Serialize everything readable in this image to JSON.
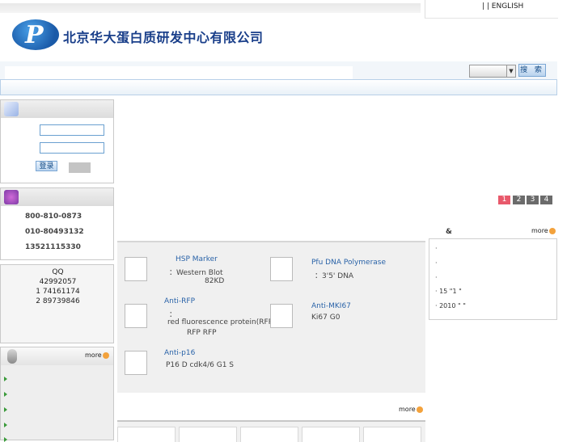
{
  "header": {
    "top_links": "|    | ENGLISH",
    "company_name": "北京华大蛋白质研发中心有限公司",
    "logo_letter": "P",
    "search_button": "搜 索",
    "search_select": ""
  },
  "login": {
    "login_button": "登录",
    "register_button": ""
  },
  "contact": {
    "phones": [
      "800-810-0873",
      "010-80493132",
      "13521115330"
    ]
  },
  "qq": {
    "label": "QQ",
    "numbers": [
      "42992057",
      "1 74161174",
      "2 89739846"
    ]
  },
  "news": {
    "more_label": "more",
    "item_count_marker": ""
  },
  "pager": [
    "1",
    "2",
    "3",
    "4"
  ],
  "products": [
    {
      "title": "HSP Marker",
      "lines": [
        "：Western Blot",
        "82KD"
      ]
    },
    {
      "title": "Pfu DNA Polymerase",
      "lines": [
        "：3'5'              DNA"
      ]
    },
    {
      "title": "Anti-RFP",
      "lines": [
        "：",
        "red fluorescence protein(RFP)",
        "RFP      RFP"
      ]
    },
    {
      "title": "Anti-MKI67",
      "lines": [
        "Ki67    G0"
      ]
    },
    {
      "title": "Anti-p16",
      "lines": [
        "P16     D     cdk4/6      G1   S"
      ]
    }
  ],
  "right_news": {
    "title": "&",
    "more_label": "more",
    "lines": [
      "·",
      "·",
      "·",
      "·   15       \"1 \"",
      "·      2010 \"    \""
    ]
  },
  "products_more_label": "more",
  "colors": {
    "brand_blue": "#1a3f8a",
    "link_blue": "#2a63a8",
    "pager_active": "#e8596b",
    "pager_inactive": "#6b6b6b",
    "bullet_green": "#3a9a3a"
  }
}
